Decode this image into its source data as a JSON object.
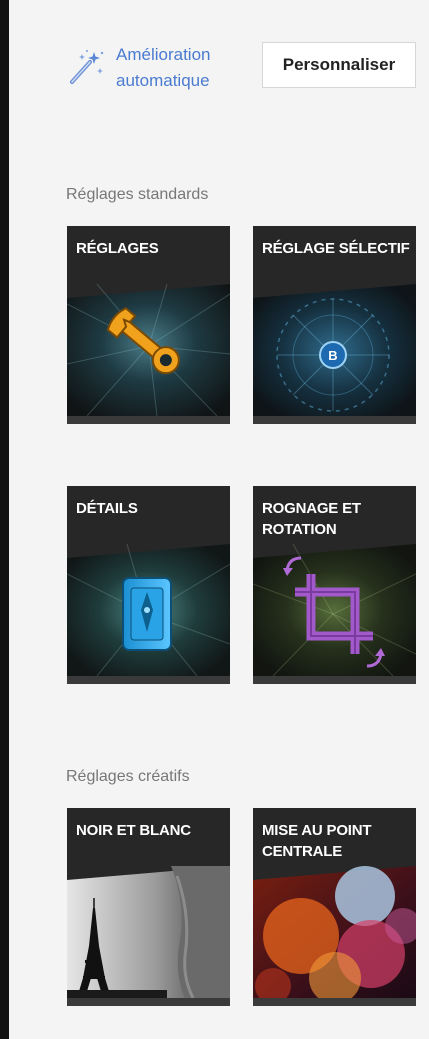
{
  "toolbar": {
    "auto_enhance_label": "Amélioration automatique",
    "personalize_label": "Personnaliser",
    "wand_icon": "magic-wand-icon"
  },
  "sections": {
    "standard_title": "Réglages standards",
    "creative_title": "Réglages créatifs"
  },
  "tiles": {
    "reglages": {
      "label": "RÉGLAGES",
      "icon": "wrench-icon"
    },
    "reglage_selectif": {
      "label": "RÉGLAGE SÉLECTIF",
      "icon": "control-point-icon",
      "badge": "B"
    },
    "details": {
      "label": "DÉTAILS",
      "icon": "sharpener-icon"
    },
    "rognage": {
      "label": "ROGNAGE ET ROTATION",
      "icon": "crop-rotate-icon"
    },
    "noir_blanc": {
      "label": "NOIR ET BLANC",
      "icon": "eiffel-tower-photo"
    },
    "mise_au_point": {
      "label": "MISE AU POINT CENTRALE",
      "icon": "bokeh-photo"
    }
  },
  "colors": {
    "link_blue": "#4a7bd0",
    "tile_bg": "#272727",
    "page_bg": "#f4f4f4"
  }
}
